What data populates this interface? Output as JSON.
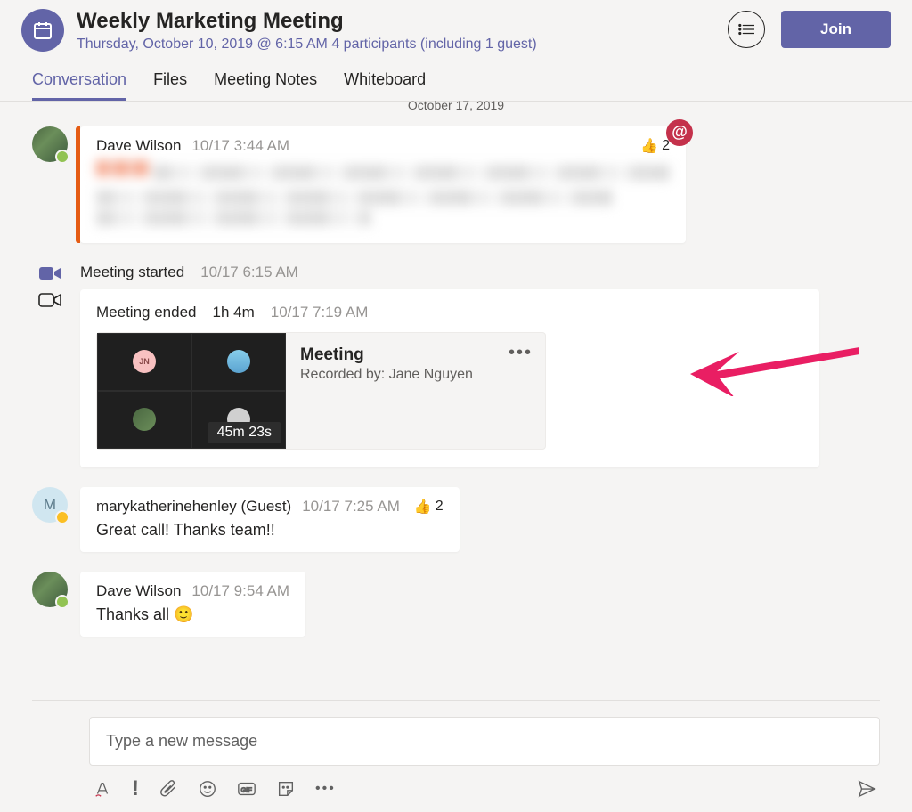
{
  "header": {
    "title": "Weekly Marketing Meeting",
    "subtitle": "Thursday, October 10, 2019 @ 6:15 AM 4 participants (including 1 guest)",
    "join_label": "Join"
  },
  "tabs": {
    "conversation": "Conversation",
    "files": "Files",
    "notes": "Meeting Notes",
    "whiteboard": "Whiteboard"
  },
  "date_separator": "October 17, 2019",
  "messages": {
    "m1": {
      "author": "Dave Wilson",
      "ts": "10/17 3:44 AM",
      "react_count": "2"
    },
    "started": {
      "label": "Meeting started",
      "ts": "10/17 6:15 AM"
    },
    "ended": {
      "label": "Meeting ended",
      "duration": "1h 4m",
      "ts": "10/17 7:19 AM",
      "recording": {
        "title": "Meeting",
        "by": "Recorded by: Jane Nguyen",
        "thumbnail_initials": "JN",
        "duration_badge": "45m 23s"
      }
    },
    "m2": {
      "author": "marykatherinehenley (Guest)",
      "ts": "10/17 7:25 AM",
      "react_count": "2",
      "body": "Great call! Thanks team!!",
      "avatar_initial": "M"
    },
    "m3": {
      "author": "Dave Wilson",
      "ts": "10/17 9:54 AM",
      "body": "Thanks all "
    }
  },
  "composer": {
    "placeholder": "Type a new message",
    "more": "•••"
  }
}
